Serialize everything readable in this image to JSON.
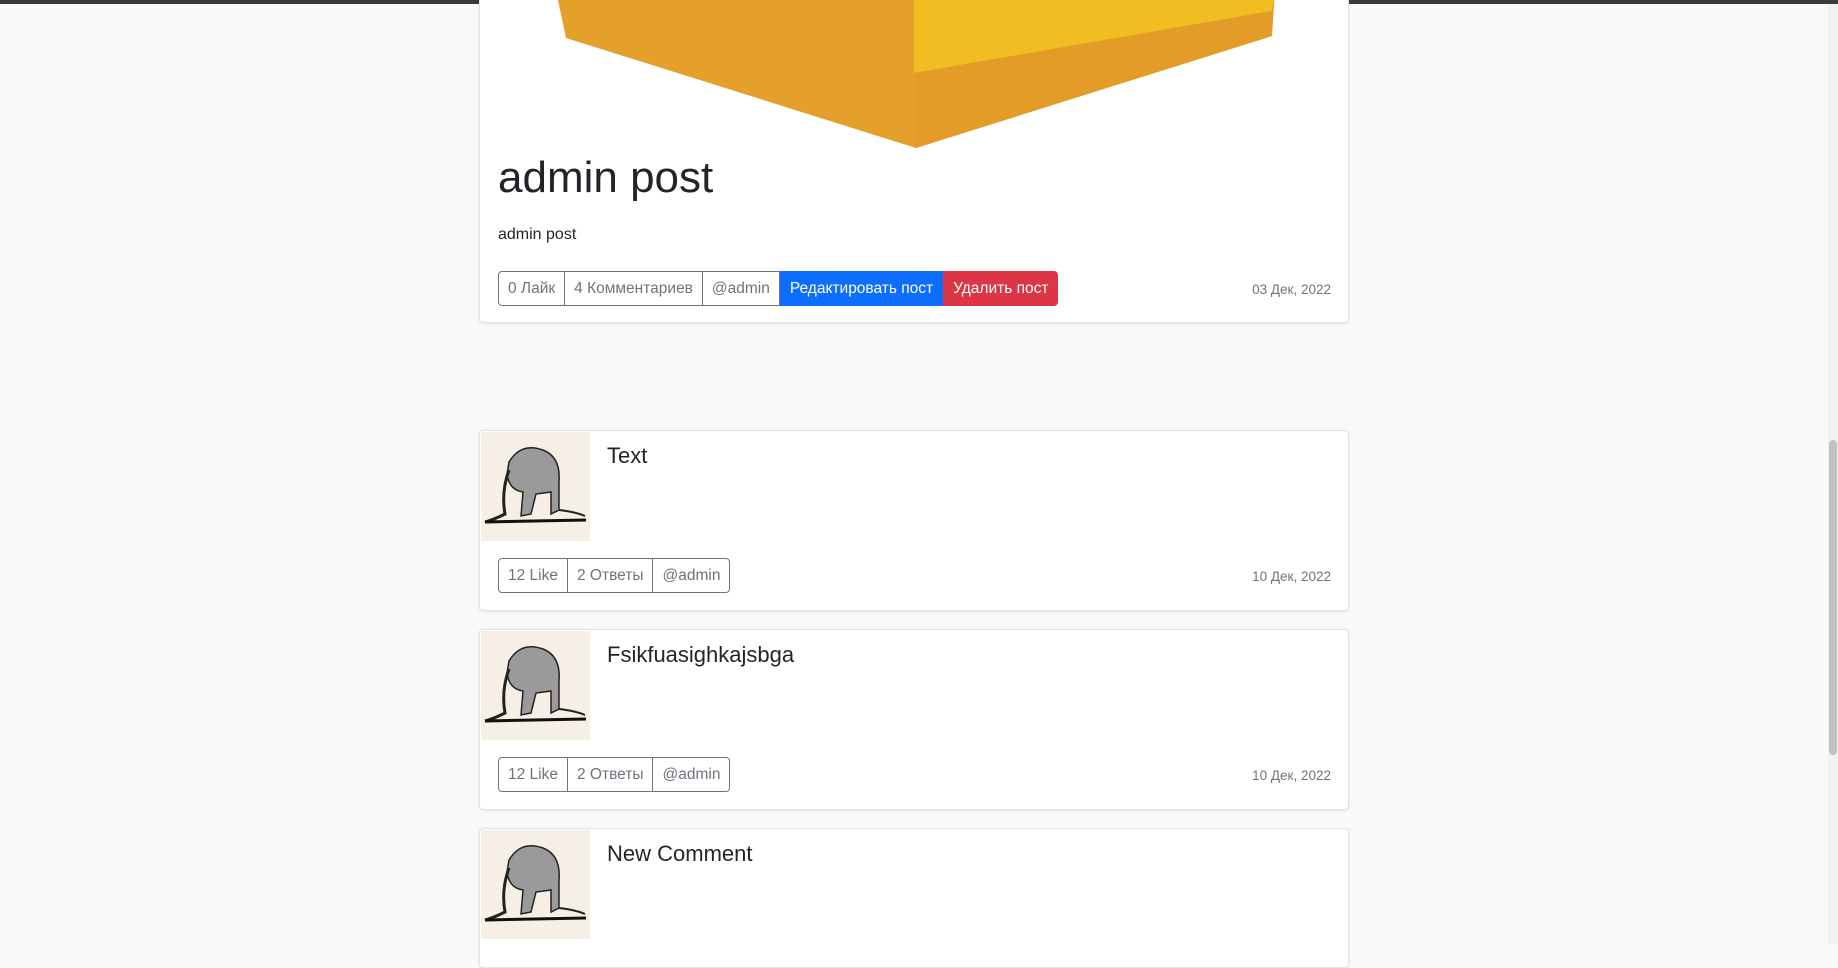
{
  "post": {
    "title": "admin post",
    "body": "admin post",
    "likes_label": "0 Лайк",
    "comments_label": "4 Комментариев",
    "author_label": "@admin",
    "edit_label": "Редактировать пост",
    "delete_label": "Удалить пост",
    "date": "03 Дек, 2022"
  },
  "comments": [
    {
      "title": "Text",
      "likes_label": "12 Like",
      "replies_label": "2 Ответы",
      "author_label": "@admin",
      "date": "10 Дек, 2022"
    },
    {
      "title": "Fsikfuasighkajsbga",
      "likes_label": "12 Like",
      "replies_label": "2 Ответы",
      "author_label": "@admin",
      "date": "10 Дек, 2022"
    },
    {
      "title": "New Comment"
    }
  ],
  "colors": {
    "primary": "#0d6efd",
    "danger": "#dc3545",
    "secondary": "#6c757d",
    "page_bg": "#f8f9fa",
    "image_orange": "#e4a02a",
    "image_yellow": "#f0bd22"
  },
  "icons": {
    "avatar": "elephant-avatar-image",
    "post_image": "box-image"
  }
}
